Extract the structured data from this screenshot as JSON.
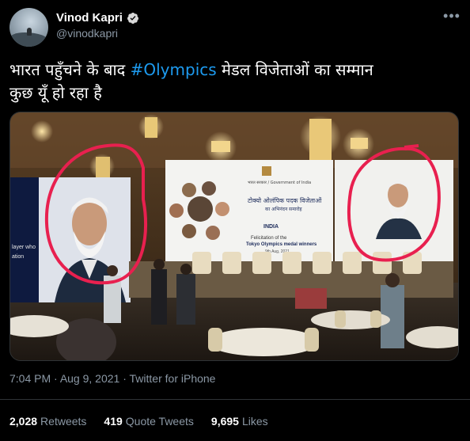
{
  "tweet": {
    "display_name": "Vinod Kapri",
    "handle": "@vinodkapri",
    "text_line1_prefix": "भारत पहुँचने के बाद ",
    "hashtag": "#Olympics",
    "text_line1_suffix": " मेडल विजेताओं का सम्मान",
    "text_line2": "कुछ यूँ हो रहा है",
    "time": "7:04 PM",
    "date": "Aug 9, 2021",
    "source": "Twitter for iPhone",
    "separator": " · "
  },
  "stats": {
    "retweets_count": "2,028",
    "retweets_label": "Retweets",
    "quotes_count": "419",
    "quotes_label": "Quote Tweets",
    "likes_count": "9,695",
    "likes_label": "Likes"
  },
  "media": {
    "banner_ministry": "भारत सरकार / Government of India",
    "banner_title_hindi": "टोक्यो ओलंपिक पदक विजेताओं",
    "banner_subtitle_hindi": "का अभिनंदन समारोह",
    "banner_india": "INDIA",
    "banner_felicitation": "Felicitation of the",
    "banner_title_en": "Tokyo Olympics medal winners",
    "banner_date": "9th Aug, 2021",
    "left_screen_text1": "layer who",
    "left_screen_text2": "ation"
  },
  "icons": {
    "verified": "verified-badge-icon",
    "more": "more-icon"
  }
}
